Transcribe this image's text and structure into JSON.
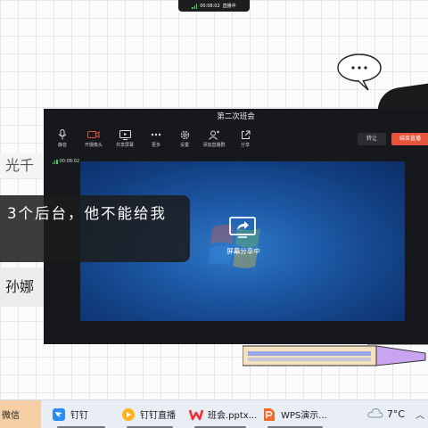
{
  "live_pill": {
    "time": "00:08:02",
    "status": "直播中"
  },
  "slide": {
    "left_labels": [
      "光千",
      "孙娜"
    ]
  },
  "meeting": {
    "title": "第二次班会",
    "toolbar": [
      {
        "id": "mute",
        "label": "静音",
        "icon": "microphone-icon"
      },
      {
        "id": "camera",
        "label": "开摄像头",
        "icon": "camera-icon"
      },
      {
        "id": "share",
        "label": "共享屏幕",
        "icon": "screen-share-icon"
      },
      {
        "id": "more",
        "label": "更多",
        "icon": "more-dots-icon"
      },
      {
        "id": "settings",
        "label": "设置",
        "icon": "gear-icon"
      },
      {
        "id": "add-presenter",
        "label": "添加直播群",
        "icon": "add-group-icon"
      },
      {
        "id": "share-link",
        "label": "分享",
        "icon": "share-out-icon"
      }
    ],
    "transfer_label": "转让",
    "end_label": "结束直播",
    "timer": "00:08:02",
    "share_status": "屏幕分享中"
  },
  "subtitle": "3个后台，他不能给我",
  "taskbar": {
    "items": [
      {
        "id": "wechat",
        "label": "微信",
        "icon": "wechat-icon",
        "active": true
      },
      {
        "id": "dingtalk",
        "label": "钉钉",
        "icon": "dingtalk-icon",
        "active": false
      },
      {
        "id": "dingtalk-live",
        "label": "钉钉直播",
        "icon": "live-icon",
        "active": false
      },
      {
        "id": "pptx",
        "label": "班会.pptx...",
        "icon": "wps-presentation-icon",
        "active": false
      },
      {
        "id": "wps",
        "label": "WPS演示...",
        "icon": "wps-icon",
        "active": false
      }
    ],
    "weather": "7°C"
  },
  "colors": {
    "end_button": "#e8533b",
    "active_task": "#f6d0a4",
    "live_signal": "#3ad15a"
  }
}
